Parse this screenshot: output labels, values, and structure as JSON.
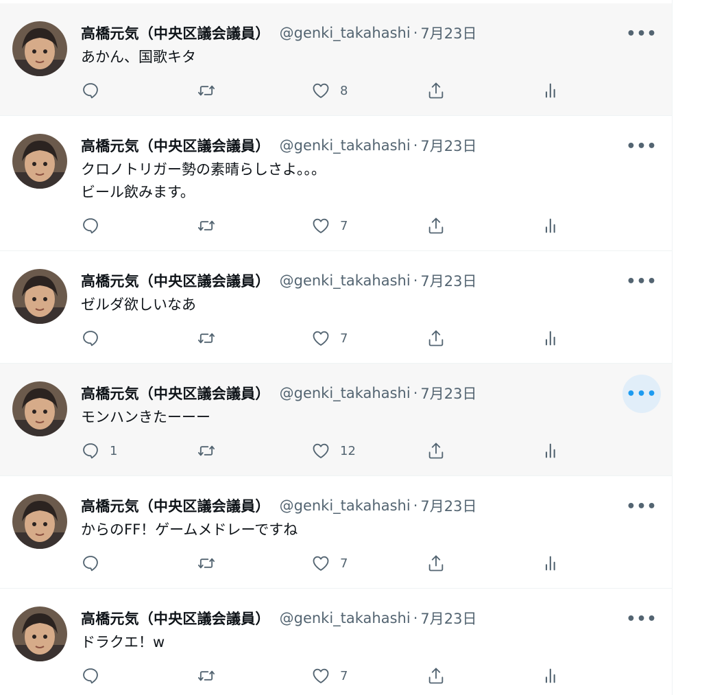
{
  "author": {
    "name": "高橋元気（中央区議会議員）",
    "handle": "@genki_takahashi",
    "separator": "·",
    "date": "7月23日"
  },
  "more_label": "•••",
  "tweets": [
    {
      "lines": [
        "あかん、国歌キタ"
      ],
      "reply_count": "",
      "like_count": "8"
    },
    {
      "lines": [
        "クロノトリガー勢の素晴らしさよ。。。",
        "ビール飲みます。"
      ],
      "reply_count": "",
      "like_count": "7"
    },
    {
      "lines": [
        "ゼルダ欲しいなあ"
      ],
      "reply_count": "",
      "like_count": "7"
    },
    {
      "lines": [
        "モンハンきたーーー"
      ],
      "reply_count": "1",
      "like_count": "12"
    },
    {
      "lines": [
        "からのFF！ゲームメドレーですね"
      ],
      "reply_count": "",
      "like_count": "7"
    },
    {
      "lines": [
        "ドラクエ！w"
      ],
      "reply_count": "",
      "like_count": "7"
    }
  ],
  "colors": {
    "text_primary": "#0f1419",
    "text_secondary": "#536471",
    "hover_background": "#f7f7f7",
    "accent": "#1d9bf0",
    "border": "#eff3f4"
  },
  "icons": [
    "reply-icon",
    "retweet-icon",
    "like-icon",
    "share-icon",
    "analytics-icon",
    "more-icon"
  ]
}
